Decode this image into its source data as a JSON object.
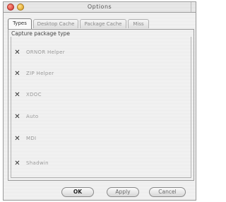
{
  "window": {
    "title": "Options"
  },
  "tabs": [
    {
      "label": "Types",
      "active": true
    },
    {
      "label": "Desktop Cache",
      "active": false
    },
    {
      "label": "Package Cache",
      "active": false
    },
    {
      "label": "Miss",
      "active": false
    }
  ],
  "group": {
    "title": "Capture package type",
    "items": [
      {
        "label": "ORNOR Helper",
        "checked": true
      },
      {
        "label": "ZIP Helper",
        "checked": true
      },
      {
        "label": "XDOC",
        "checked": true
      },
      {
        "label": "Auto",
        "checked": true
      },
      {
        "label": "MDI",
        "checked": true
      },
      {
        "label": "Shadwin",
        "checked": true
      }
    ]
  },
  "buttons": {
    "ok": "OK",
    "apply": "Apply",
    "cancel": "Cancel"
  },
  "check_glyph": "✕"
}
